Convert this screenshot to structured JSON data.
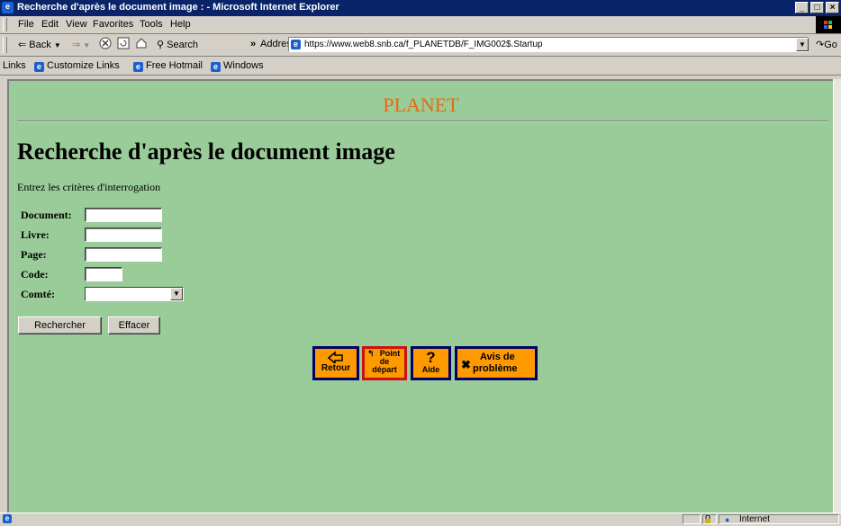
{
  "window": {
    "title": "Recherche d'après le document image : - Microsoft Internet Explorer",
    "controls": [
      "_",
      "□",
      "×"
    ]
  },
  "menu": [
    "File",
    "Edit",
    "View",
    "Favorites",
    "Tools",
    "Help"
  ],
  "toolbar": {
    "back": "Back",
    "search": "Search",
    "chevron": "»",
    "address_label": "Address",
    "url": "https://www.web8.snb.ca/f_PLANETDB/F_IMG002$.Startup",
    "go": "Go"
  },
  "links": {
    "label": "Links",
    "items": [
      "Customize Links",
      "Free Hotmail",
      "Windows"
    ]
  },
  "page": {
    "brand": "PLANET",
    "heading": "Recherche d'après le document image",
    "instructions": "Entrez les critères d'interrogation",
    "fields": [
      {
        "label": "Document:",
        "value": ""
      },
      {
        "label": "Livre:",
        "value": ""
      },
      {
        "label": "Page:",
        "value": ""
      },
      {
        "label": "Code:",
        "value": ""
      },
      {
        "label": "Comté:",
        "value": ""
      }
    ],
    "buttons": {
      "search": "Rechercher",
      "clear": "Effacer"
    },
    "nav": {
      "retour": "Retour",
      "point_line1": "Point",
      "point_line2": "de",
      "point_line3": "départ",
      "aide": "Aide",
      "aide_mark": "?",
      "avis_line1": "Avis de",
      "avis_line2": "problème"
    }
  },
  "status": {
    "zone": "Internet"
  },
  "colors": {
    "page_bg": "#99cc99",
    "brand": "#e86a10",
    "nav_bg": "#ff9900",
    "title_bg": "#0a246a"
  }
}
